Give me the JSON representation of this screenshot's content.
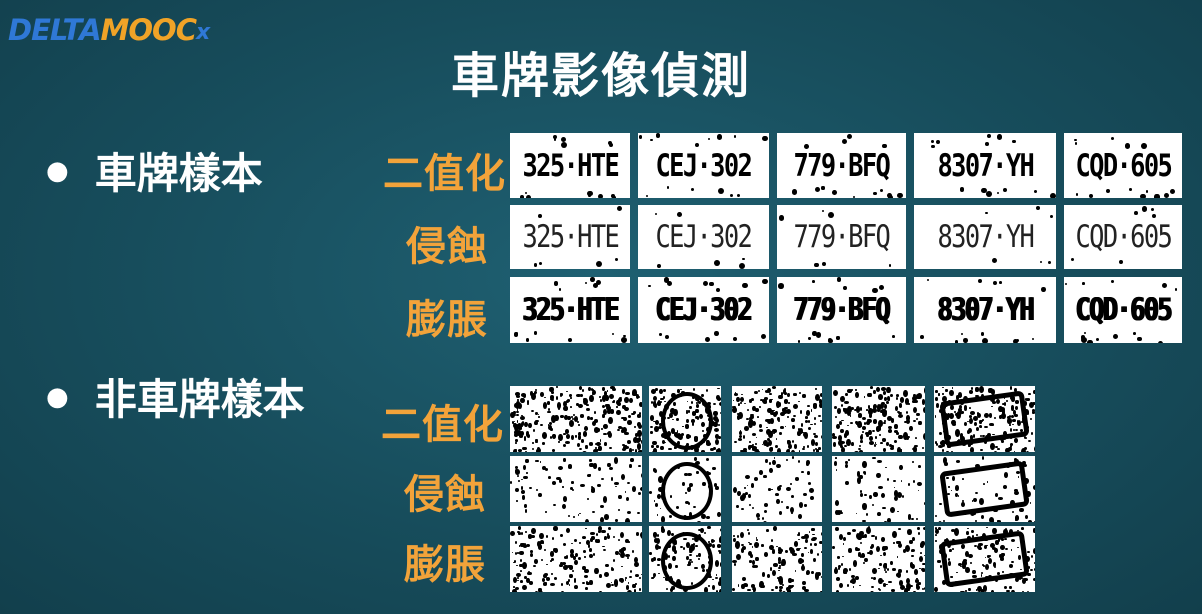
{
  "logo": {
    "part1": "DELTA",
    "part2": "MOOC",
    "part3": "x"
  },
  "title": "車牌影像偵測",
  "bullets": {
    "plate_samples": "車牌樣本",
    "non_plate_samples": "非車牌樣本"
  },
  "labels": {
    "binarize": "二值化",
    "erode": "侵蝕",
    "dilate": "膨脹"
  },
  "plates": [
    "325·HTE",
    "CEJ·302",
    "779·BFQ",
    "8307·YH",
    "CQD·605"
  ],
  "colors": {
    "background": "#174d5c",
    "title": "#ffffff",
    "label": "#f2a33a"
  }
}
